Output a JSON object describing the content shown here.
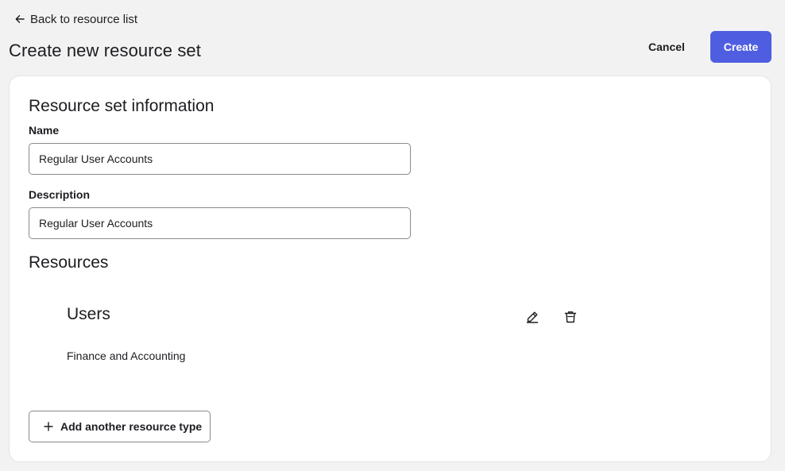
{
  "header": {
    "back_label": "Back to resource list",
    "title": "Create new resource set",
    "cancel_label": "Cancel",
    "create_label": "Create"
  },
  "info_section": {
    "title": "Resource set information",
    "name_label": "Name",
    "name_value": "Regular User Accounts",
    "description_label": "Description",
    "description_value": "Regular User Accounts"
  },
  "resources_section": {
    "title": "Resources",
    "items": [
      {
        "type": "Users",
        "detail": "Finance and Accounting",
        "edit_icon": "pencil-icon",
        "delete_icon": "trash-icon"
      }
    ],
    "add_label": "Add another resource type",
    "add_icon": "plus-icon"
  },
  "colors": {
    "accent": "#4f5ee1",
    "page_background": "#f2f2f2",
    "card_background": "#ffffff",
    "text": "#1d1d21"
  }
}
